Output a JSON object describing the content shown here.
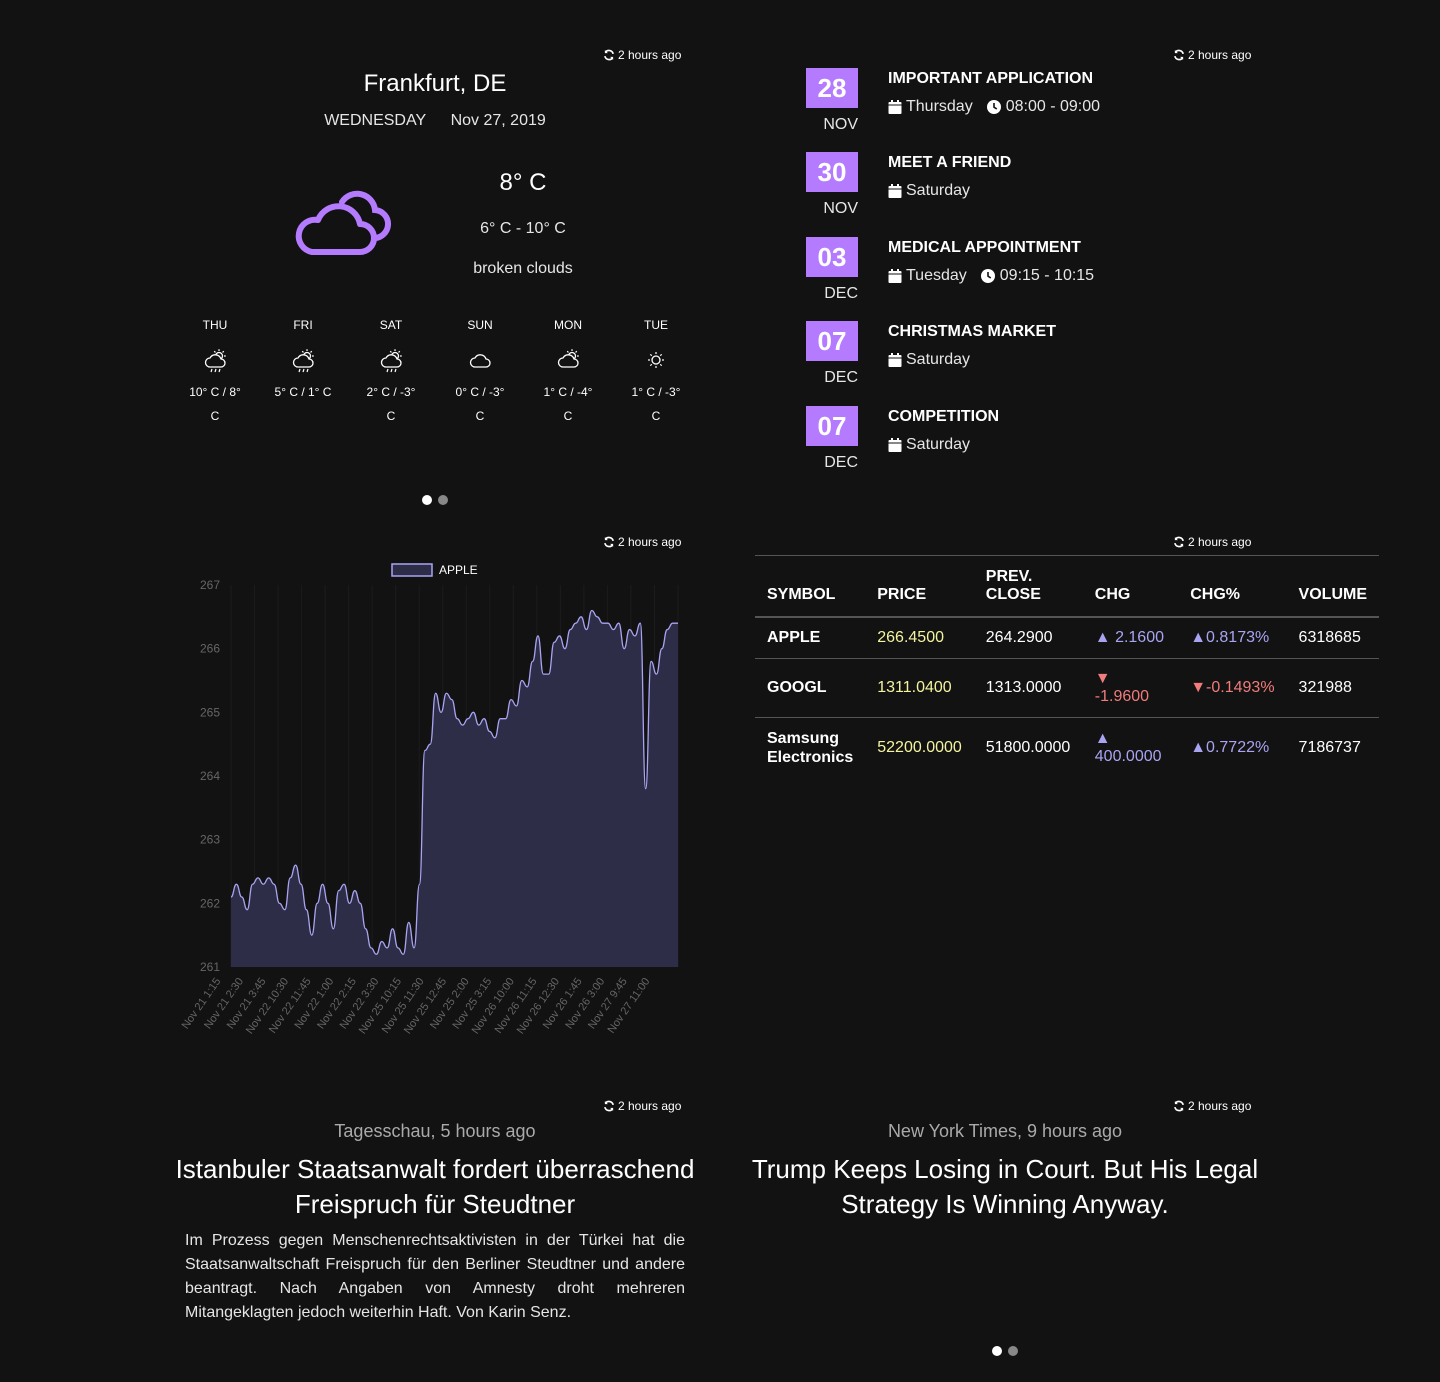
{
  "refresh_label": "2 hours ago",
  "weather": {
    "city": "Frankfurt, DE",
    "weekday": "WEDNESDAY",
    "date": "Nov 27, 2019",
    "temp": "8° C",
    "range": "6° C - 10° C",
    "description": "broken clouds",
    "icon": "broken-clouds-icon",
    "forecast": [
      {
        "day": "THU",
        "icon": "sun-cloud-rain-icon",
        "temp1": "10° C / 8°",
        "temp2": "C"
      },
      {
        "day": "FRI",
        "icon": "sun-cloud-rain-icon",
        "temp1": "5° C / 1° C",
        "temp2": ""
      },
      {
        "day": "SAT",
        "icon": "sun-cloud-rain-icon",
        "temp1": "2° C / -3°",
        "temp2": "C"
      },
      {
        "day": "SUN",
        "icon": "cloud-icon",
        "temp1": "0° C / -3°",
        "temp2": "C"
      },
      {
        "day": "MON",
        "icon": "sun-cloud-icon",
        "temp1": "1° C / -4°",
        "temp2": "C"
      },
      {
        "day": "TUE",
        "icon": "sun-icon",
        "temp1": "1° C / -3°",
        "temp2": "C"
      }
    ]
  },
  "calendar": {
    "events": [
      {
        "day": "28",
        "month": "NOV",
        "title": "IMPORTANT APPLICATION",
        "weekday": "Thursday",
        "time": "08:00 - 09:00"
      },
      {
        "day": "30",
        "month": "NOV",
        "title": "MEET A FRIEND",
        "weekday": "Saturday",
        "time": ""
      },
      {
        "day": "03",
        "month": "DEC",
        "title": "MEDICAL APPOINTMENT",
        "weekday": "Tuesday",
        "time": "09:15 - 10:15"
      },
      {
        "day": "07",
        "month": "DEC",
        "title": "CHRISTMAS MARKET",
        "weekday": "Saturday",
        "time": ""
      },
      {
        "day": "07",
        "month": "DEC",
        "title": "COMPETITION",
        "weekday": "Saturday",
        "time": ""
      }
    ]
  },
  "chart_data": {
    "type": "area",
    "title": "",
    "legend": "APPLE",
    "legend_position": "top-center",
    "ylim": [
      261,
      267
    ],
    "yticks": [
      "261",
      "262",
      "263",
      "264",
      "265",
      "266",
      "267"
    ],
    "xticks": [
      "Nov 21 1:15",
      "Nov 21 2:30",
      "Nov 21 3:45",
      "Nov 22 10:30",
      "Nov 22 11:45",
      "Nov 22 1:00",
      "Nov 22 2:15",
      "Nov 22 3:30",
      "Nov 25 10:15",
      "Nov 25 11:30",
      "Nov 25 12:45",
      "Nov 25 2:00",
      "Nov 25 3:15",
      "Nov 26 10:00",
      "Nov 26 11:15",
      "Nov 26 12:30",
      "Nov 26 1:45",
      "Nov 26 3:00",
      "Nov 27 9:45",
      "Nov 27 11:00"
    ],
    "grid": true,
    "series": [
      {
        "name": "APPLE",
        "values": [
          262.1,
          262.3,
          262.1,
          261.9,
          262.3,
          262.4,
          262.3,
          262.4,
          262.3,
          262.0,
          261.9,
          262.4,
          262.6,
          262.3,
          261.9,
          261.5,
          262.0,
          262.3,
          262.0,
          261.6,
          262.2,
          262.3,
          262.0,
          262.2,
          262.0,
          261.6,
          261.3,
          261.2,
          261.4,
          261.3,
          261.6,
          261.3,
          261.2,
          261.7,
          261.3,
          262.3,
          264.4,
          264.5,
          265.3,
          265.0,
          265.3,
          265.2,
          264.9,
          264.8,
          264.9,
          265.0,
          264.8,
          264.9,
          264.7,
          264.6,
          264.9,
          264.9,
          265.2,
          265.1,
          265.5,
          265.4,
          265.8,
          266.2,
          265.6,
          265.6,
          266.1,
          266.2,
          266.0,
          266.3,
          266.4,
          266.5,
          266.3,
          266.6,
          266.5,
          266.4,
          266.4,
          266.3,
          266.4,
          266.0,
          266.3,
          266.2,
          266.4,
          263.8,
          265.8,
          265.6,
          266.0,
          266.3,
          266.4,
          266.4
        ]
      }
    ],
    "colors": {
      "line": "#a9a4f2",
      "fill": "#2e2d47"
    }
  },
  "stocks": {
    "headers": [
      "SYMBOL",
      "PRICE",
      "PREV. CLOSE",
      "CHG",
      "CHG%",
      "VOLUME"
    ],
    "rows": [
      {
        "symbol": "APPLE",
        "price": "266.4500",
        "prev": "264.2900",
        "chg": "▲ 2.1600",
        "chgp": "▲0.8173%",
        "volume": "6318685",
        "dir": "up"
      },
      {
        "symbol": "GOOGL",
        "price": "1311.0400",
        "prev": "1313.0000",
        "chg": "▼ -1.9600",
        "chgp": "▼-0.1493%",
        "volume": "321988",
        "dir": "down"
      },
      {
        "symbol": "Samsung Electronics",
        "price": "52200.0000",
        "prev": "51800.0000",
        "chg": "▲ 400.0000",
        "chgp": "▲0.7722%",
        "volume": "7186737",
        "dir": "up"
      }
    ]
  },
  "news_left": {
    "source": "Tagesschau, 5 hours ago",
    "title": "Istanbuler Staatsanwalt fordert überraschend Freispruch für Steudtner",
    "body": "Im Prozess gegen Menschenrechtsaktivisten in der Türkei hat die Staatsanwaltschaft Freispruch für den Berliner Steudtner und andere beantragt. Nach Angaben von Amnesty droht mehreren Mitangeklagten jedoch weiterhin Haft. Von Karin Senz."
  },
  "news_right": {
    "source": "New York Times, 9 hours ago",
    "title": "Trump Keeps Losing in Court. But His Legal Strategy Is Winning Anyway."
  },
  "colors": {
    "accent": "#b57bff",
    "background": "#121212",
    "up": "#a9a4f2",
    "down": "#f07c7c",
    "price": "#f4f4a0"
  }
}
